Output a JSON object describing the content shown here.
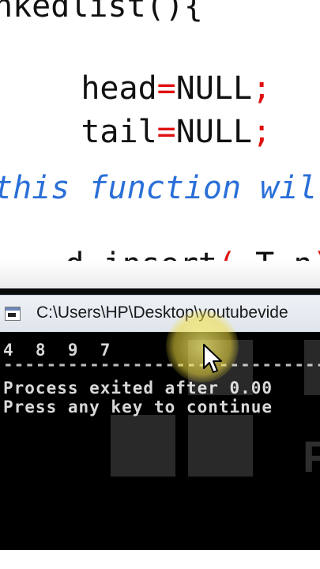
{
  "editor": {
    "cut_line": "nkedlist(){",
    "head_line": {
      "name": "head",
      "eq": "=",
      "value": "NULL",
      "semi": ";"
    },
    "tail_line": {
      "name": "tail",
      "eq": "=",
      "value": "NULL",
      "semi": ";"
    },
    "comment_line": "this function wil",
    "insert_line": {
      "prefix": "d insert",
      "open": "(",
      "args": " T n",
      "close": ")",
      "brace": "{"
    }
  },
  "console": {
    "title": "C:\\Users\\HP\\Desktop\\youtubevide",
    "output_numbers": "4  8  9  7",
    "dashes": "--------------------------------------",
    "process_line": "Process exited after 0.00",
    "press_line": "Press any key to continue"
  },
  "overlay": {
    "ghost_letter": "F"
  },
  "colors": {
    "code_text": "#111111",
    "code_operator": "#e01010",
    "comment": "#2a6fd8",
    "console_bg": "#000000",
    "console_text": "#d8d8d8",
    "cursor_highlight": "#f0dc3c"
  },
  "icons": {
    "app": "console-app-icon",
    "cursor": "mouse-pointer-icon"
  }
}
